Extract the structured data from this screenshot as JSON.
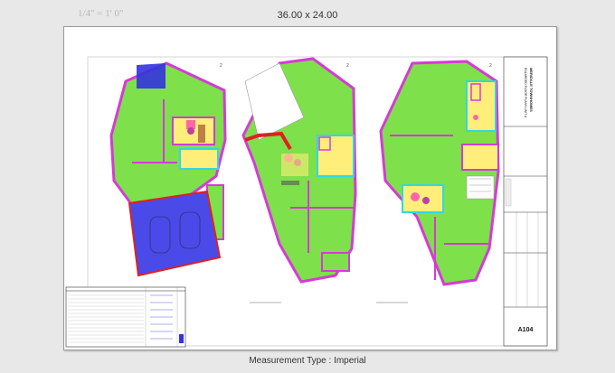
{
  "viewer": {
    "scale": "1/4\" = 1' 0\"",
    "sheet_size": "36.00 x 24.00",
    "measurement_type": "Measurement Type : Imperial"
  },
  "sheet": {
    "number": "A104",
    "project_title": "MERIDALE TOWNHOMES",
    "project_subtitle": "ENLARGED FLOOR PLANS UNIT A",
    "detail_markers": [
      "2",
      "2",
      "2"
    ]
  },
  "colors": {
    "room_fill": "#7ee04a",
    "wall": "#d63ad6",
    "wet_area": "#ffef7a",
    "garage": "#3333dd",
    "exterior_wall": "#e02020",
    "cyan_zone": "#33d6e6"
  }
}
